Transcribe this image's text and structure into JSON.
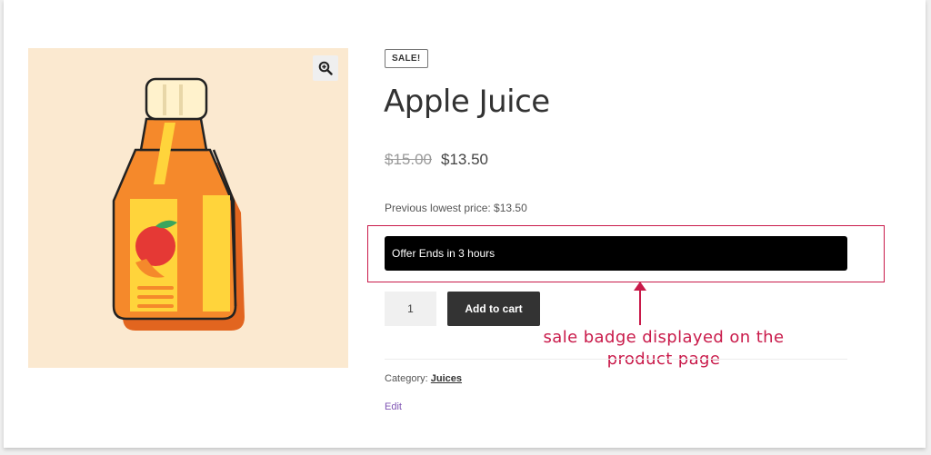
{
  "product": {
    "sale_badge": "SALE!",
    "title": "Apple Juice",
    "old_price": "$15.00",
    "price": "$13.50",
    "previous_lowest": "Previous lowest price: $13.50",
    "offer_text": "Offer Ends in 3 hours",
    "quantity": "1",
    "add_to_cart_label": "Add to cart",
    "category_label": "Category:",
    "category_value": "Juices",
    "edit_label": "Edit"
  },
  "annotation": {
    "line1": "sale badge displayed on the",
    "line2": "product page"
  },
  "icons": {
    "zoom": "zoom-in-icon",
    "product_image": "juice-bottle-icon"
  },
  "colors": {
    "accent": "#c91a4a",
    "offer_bar": "#000000",
    "button": "#333333",
    "image_bg": "#fbe9d0",
    "edit_link": "#7f54b3"
  }
}
